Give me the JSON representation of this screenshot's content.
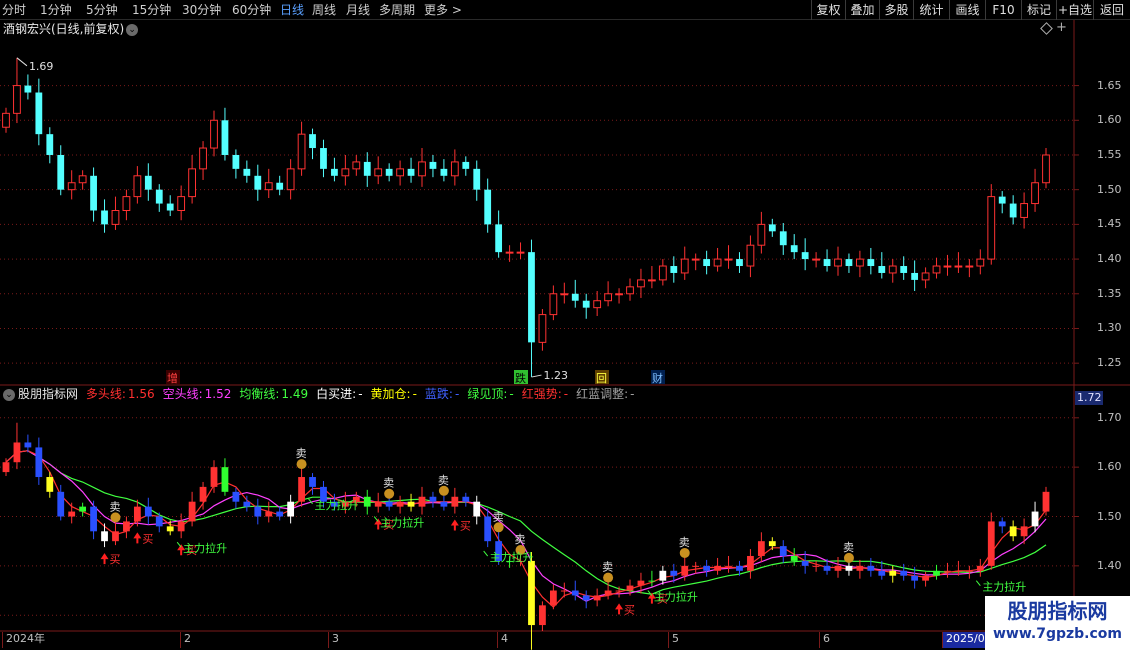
{
  "toolbar": {
    "timeframes": [
      {
        "label": "分时",
        "active": false
      },
      {
        "label": "1分钟",
        "active": false
      },
      {
        "label": "5分钟",
        "active": false
      },
      {
        "label": "15分钟",
        "active": false
      },
      {
        "label": "30分钟",
        "active": false
      },
      {
        "label": "60分钟",
        "active": false
      },
      {
        "label": "日线",
        "active": true
      },
      {
        "label": "周线",
        "active": false
      },
      {
        "label": "月线",
        "active": false
      },
      {
        "label": "多周期",
        "active": false
      },
      {
        "label": "更多 >",
        "active": false
      }
    ],
    "buttons": [
      "复权",
      "叠加",
      "多股",
      "统计",
      "画线",
      "F10",
      "标记",
      "+自选",
      "返回"
    ]
  },
  "main_chart": {
    "title": "酒钢宏兴(日线,前复权)",
    "high_label": "1.69",
    "low_label": "1.23",
    "price_ticks": [
      "1.65",
      "1.60",
      "1.55",
      "1.50",
      "1.45",
      "1.40",
      "1.35",
      "1.30",
      "1.25"
    ],
    "events": [
      {
        "label": "增",
        "color": "#ff4040",
        "bg": "#3a0000"
      },
      {
        "label": "跌",
        "color": "#000000",
        "bg": "#30c030"
      },
      {
        "label": "回",
        "color": "#ffff40",
        "bg": "#604000"
      },
      {
        "label": "财",
        "color": "#80c0ff",
        "bg": "#002050"
      }
    ]
  },
  "indicator": {
    "name": "股朋指标网",
    "items": [
      {
        "label": "多头线:",
        "value": "1.56",
        "color": "#ff3030"
      },
      {
        "label": "空头线:",
        "value": "1.52",
        "color": "#ff40ff"
      },
      {
        "label": "均衡线:",
        "value": "1.49",
        "color": "#40ff40"
      },
      {
        "label": "白买进:",
        "value": "-",
        "color": "#ffffff"
      },
      {
        "label": "黄加仓:",
        "value": "-",
        "color": "#ffff00"
      },
      {
        "label": "蓝跌:",
        "value": "-",
        "color": "#4060ff"
      },
      {
        "label": "绿见顶:",
        "value": "-",
        "color": "#40ff40"
      },
      {
        "label": "红强势:",
        "value": "-",
        "color": "#ff3030"
      },
      {
        "label": "红蓝调整:",
        "value": "-",
        "color": "#a0a0a0"
      }
    ],
    "price_ticks": [
      "1.70",
      "1.60",
      "1.50",
      "1.40",
      "1.30"
    ],
    "current_value": "1.72",
    "signals": {
      "sell": "卖",
      "buy": "买",
      "rally": "主力拉升",
      "rally_alt": "主力拉升",
      "rally_last": "主力拉升"
    }
  },
  "dates": [
    {
      "label": "2024年",
      "highlight": false
    },
    {
      "label": "2",
      "highlight": false
    },
    {
      "label": "3",
      "highlight": false
    },
    {
      "label": "4",
      "highlight": false
    },
    {
      "label": "5",
      "highlight": false
    },
    {
      "label": "6",
      "highlight": false
    },
    {
      "label": "2025/08",
      "highlight": true
    }
  ],
  "watermark": {
    "line1": "股朋指标网",
    "line2": "www.7gpzb.com"
  },
  "colors": {
    "up": "#ff3232",
    "down": "#54ffff",
    "grid": "#7a1a1a",
    "ma_red": "#ff3030",
    "ma_magenta": "#ff40ff",
    "ma_green": "#40ff40"
  },
  "chart_data": {
    "type": "candlestick",
    "title": "酒钢宏兴(日线,前复权)",
    "price_range": [
      1.22,
      1.72
    ],
    "indicator_range": [
      1.27,
      1.73
    ],
    "ohlc_close_sequence": [
      1.61,
      1.65,
      1.64,
      1.58,
      1.55,
      1.5,
      1.51,
      1.52,
      1.47,
      1.45,
      1.47,
      1.49,
      1.52,
      1.5,
      1.48,
      1.47,
      1.49,
      1.53,
      1.56,
      1.6,
      1.55,
      1.53,
      1.52,
      1.5,
      1.51,
      1.5,
      1.53,
      1.58,
      1.56,
      1.53,
      1.52,
      1.53,
      1.54,
      1.52,
      1.53,
      1.52,
      1.53,
      1.52,
      1.54,
      1.53,
      1.52,
      1.54,
      1.53,
      1.5,
      1.45,
      1.41,
      1.41,
      1.41,
      1.28,
      1.32,
      1.35,
      1.35,
      1.34,
      1.33,
      1.34,
      1.35,
      1.35,
      1.36,
      1.37,
      1.37,
      1.39,
      1.38,
      1.4,
      1.4,
      1.39,
      1.4,
      1.4,
      1.39,
      1.42,
      1.45,
      1.44,
      1.42,
      1.41,
      1.4,
      1.4,
      1.39,
      1.4,
      1.39,
      1.4,
      1.39,
      1.38,
      1.39,
      1.38,
      1.37,
      1.38,
      1.39,
      1.39,
      1.39,
      1.39,
      1.4,
      1.49,
      1.48,
      1.46,
      1.48,
      1.51,
      1.55
    ],
    "high": 1.69,
    "low": 1.23
  }
}
